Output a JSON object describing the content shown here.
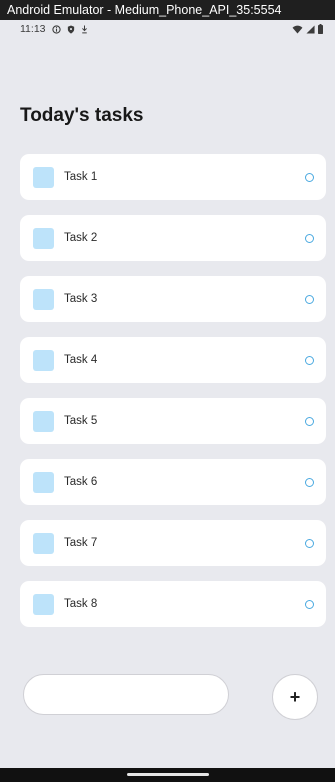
{
  "window": {
    "title": "Android Emulator - Medium_Phone_API_35:5554"
  },
  "status_bar": {
    "time": "11:13",
    "left_icons": [
      "info-icon",
      "shield-icon",
      "download-icon"
    ],
    "right_icons": [
      "wifi-icon",
      "signal-icon",
      "battery-icon"
    ]
  },
  "page": {
    "title": "Today's tasks"
  },
  "tasks": [
    {
      "label": "Task 1"
    },
    {
      "label": "Task 2"
    },
    {
      "label": "Task 3"
    },
    {
      "label": "Task 4"
    },
    {
      "label": "Task 5"
    },
    {
      "label": "Task 6"
    },
    {
      "label": "Task 7"
    },
    {
      "label": "Task 8"
    }
  ],
  "composer": {
    "input_value": "",
    "input_placeholder": "",
    "add_label": "+"
  },
  "colors": {
    "background": "#e8e9ee",
    "checkbox": "#bde3fa",
    "status_ring": "#4aa9e0",
    "title_bar": "#1f1f1f"
  }
}
